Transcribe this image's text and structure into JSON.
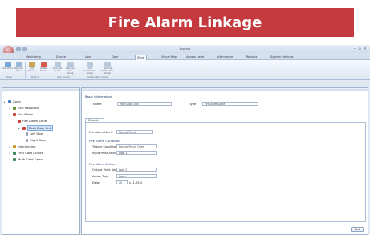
{
  "banner": {
    "title": "Fire Alarm Linkage"
  },
  "window": {
    "title": "Express",
    "controls": [
      "–",
      "▫",
      "×"
    ]
  },
  "tabs": [
    "Monitoring",
    "Device",
    "User",
    "Door",
    "Zone",
    "Visual Map",
    "Access Level",
    "Attendance",
    "Reports",
    "System Settings"
  ],
  "active_tab": "Zone",
  "ribbon": {
    "buttons": [
      {
        "label": "Add Zone",
        "color": "#7aa6d6"
      },
      {
        "label": "Remove Zone",
        "color": "#9bb8d8"
      },
      {
        "label": "Add Device",
        "color": "#c8a55a"
      },
      {
        "label": "Delete Device",
        "color": "#d35b4a"
      },
      {
        "label": "Add User Group",
        "color": "#b9c9dc"
      },
      {
        "label": "Remove User Group",
        "color": "#b9c9dc"
      },
      {
        "label": "Add Combination Group",
        "color": "#b9c9dc"
      },
      {
        "label": "Remove Combination Group",
        "color": "#b9c9dc"
      }
    ],
    "groups": [
      "Zone",
      "Device",
      "User Group",
      "Combination Group"
    ]
  },
  "tree": [
    {
      "label": "Zone",
      "level": 0,
      "icon_color": "#4a7cc4"
    },
    {
      "label": "Anti Passback",
      "level": 1,
      "icon_color": "#6a8e3a"
    },
    {
      "label": "Fire Alarm",
      "level": 1,
      "icon_color": "#d04038"
    },
    {
      "label": "Fire Alarm Zone",
      "level": 2,
      "icon_color": "#d04038"
    },
    {
      "label": "Main Door Unit",
      "level": 3,
      "icon_color": "#d04038"
    },
    {
      "label": "Left Door",
      "level": 4,
      "icon_color": "#8a9ab0"
    },
    {
      "label": "Right Door",
      "level": 4,
      "icon_color": "#8a9ab0"
    },
    {
      "label": "Interlocking",
      "level": 1,
      "icon_color": "#c89a2a"
    },
    {
      "label": "First Card Unlock",
      "level": 1,
      "icon_color": "#3a8a5a"
    },
    {
      "label": "Multi-Card Open",
      "level": 1,
      "icon_color": "#3a8a5a"
    }
  ],
  "basic": {
    "section": "Basic Information",
    "name_label": "Name",
    "name_value": "Main Door Unit",
    "type_label": "Type",
    "type_value": "Fire Alarm Zone"
  },
  "details": {
    "tab": "Details",
    "alarm_name_label": "Fire Alarm Name",
    "alarm_name_value": "Normal Punch",
    "condition_section": "Fire Alarm Condition",
    "trigger_label": "Trigger Condition",
    "trigger_value": "Normal Punch Open",
    "input_label": "Input Point Address",
    "input_value": "Door 1",
    "action_section": "Fire Alarm Action",
    "output_label": "Output Point Address",
    "output_value": "Lock 2",
    "action_type_label": "Action Type",
    "action_type_value": "Open",
    "delay_label": "Delay",
    "delay_value": "20",
    "delay_unit": "s (1-255)"
  },
  "exit_label": "Exit"
}
